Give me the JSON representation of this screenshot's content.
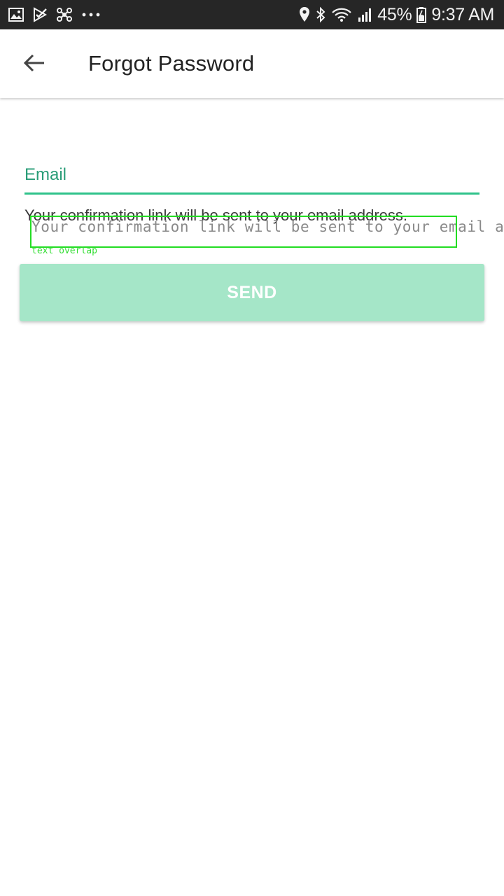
{
  "status_bar": {
    "battery": "45%",
    "time": "9:37 AM",
    "icons_left": [
      "image-icon",
      "checkmark-play-icon",
      "network-icon",
      "more-dots-icon"
    ],
    "icons_right": [
      "location-icon",
      "bluetooth-icon",
      "wifi-icon",
      "signal-icon",
      "battery-icon"
    ]
  },
  "app_bar": {
    "title": "Forgot Password",
    "back_icon": "arrow-left-icon"
  },
  "form": {
    "email_label": "Email",
    "email_value": "",
    "helper_text": "Your confirmation link will be sent to your email address."
  },
  "overlay": {
    "text": "Your confirmation link will be sent to your email address.?",
    "caption": "text overlap"
  },
  "send_button": {
    "label": "SEND"
  },
  "colors": {
    "status_bar_bg": "#262626",
    "accent": "#2ec28a",
    "label_green": "#2a9d78",
    "button_bg": "#a5e6c8",
    "overlay_box": "#22dd22"
  }
}
